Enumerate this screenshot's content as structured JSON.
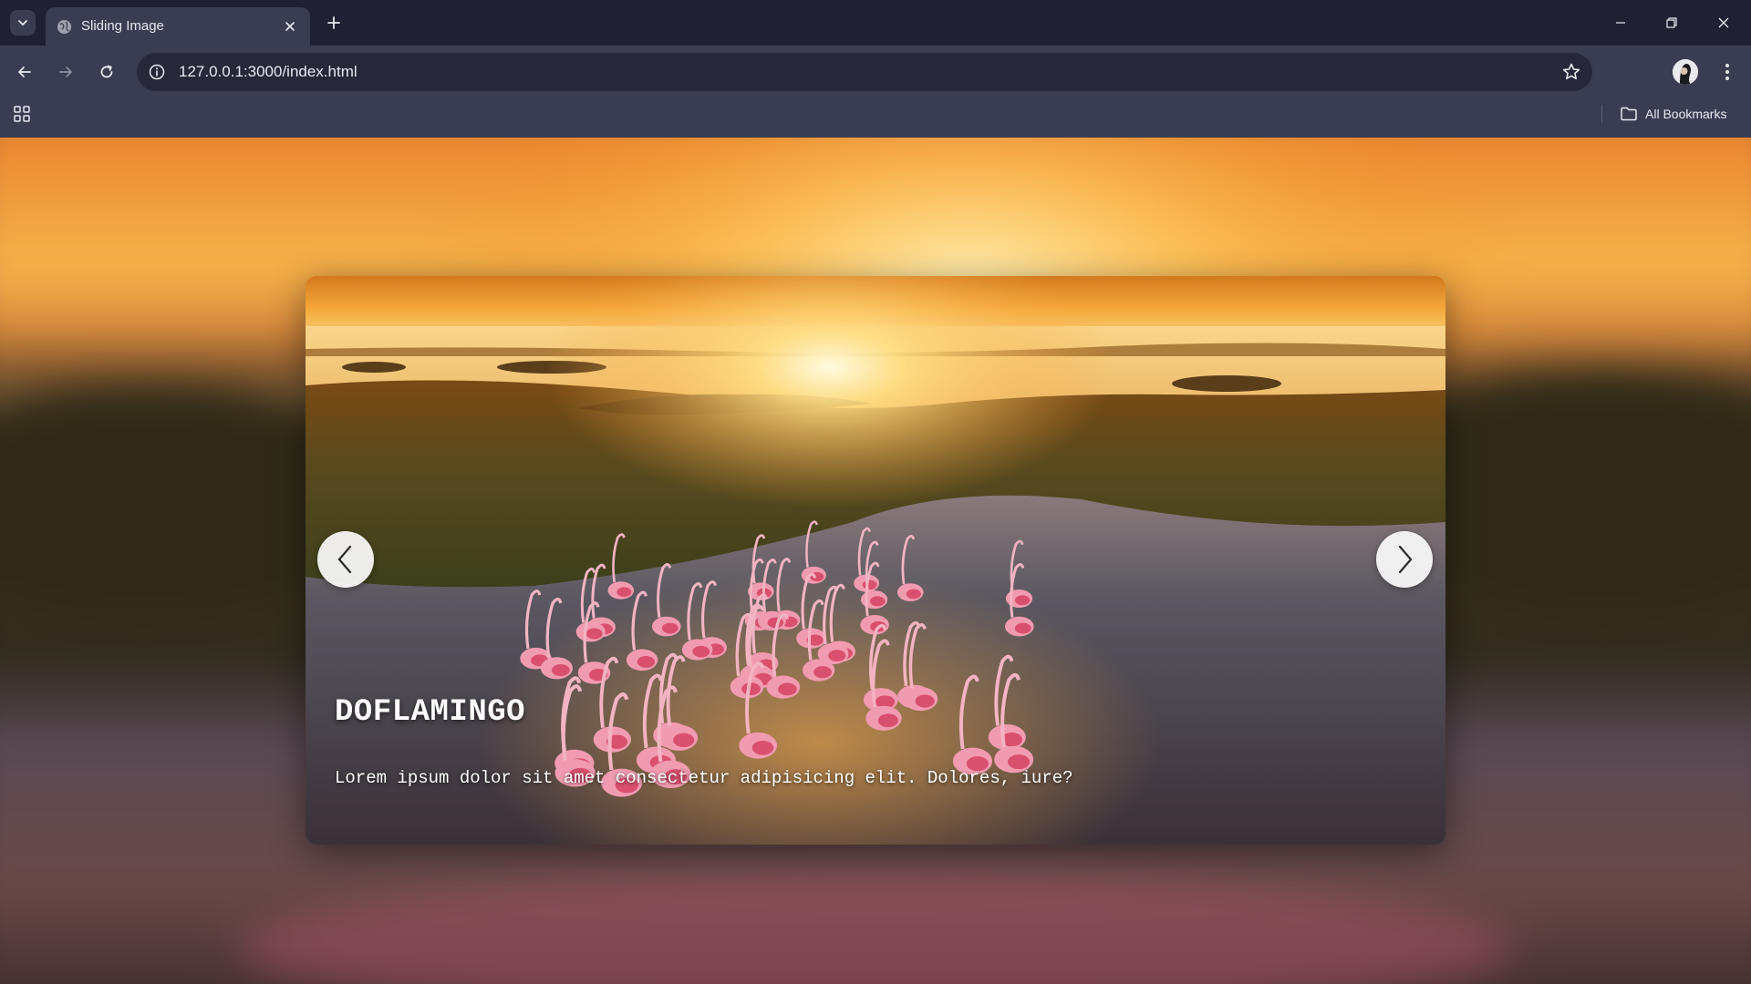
{
  "browser": {
    "tab_title": "Sliding Image",
    "url": "127.0.0.1:3000/index.html",
    "all_bookmarks_label": "All Bookmarks"
  },
  "icons": {
    "tab_search": "chevron-down-icon",
    "favicon": "globe-icon",
    "tab_close": "close-icon",
    "new_tab": "plus-icon",
    "minimize": "minimize-icon",
    "restore": "restore-icon",
    "close_window": "close-icon",
    "back": "arrow-left-icon",
    "forward": "arrow-right-icon",
    "reload": "reload-icon",
    "site_info": "info-icon",
    "bookmark_star": "star-icon",
    "profile": "avatar",
    "menu": "kebab-icon",
    "apps": "grid-icon",
    "bookmarks_folder": "folder-icon",
    "prev_slide": "chevron-left-icon",
    "next_slide": "chevron-right-icon"
  },
  "slider": {
    "title": "DOFLAMINGO",
    "description": "Lorem ipsum dolor sit amet consectetur adipisicing elit. Dolores, iure?"
  },
  "colors": {
    "chrome_dark": "#1f2133",
    "chrome_light": "#3a3c51",
    "omnibox": "#262839",
    "sunset_orange": "#f08a1c",
    "flamingo_pink": "#f19bb0"
  }
}
